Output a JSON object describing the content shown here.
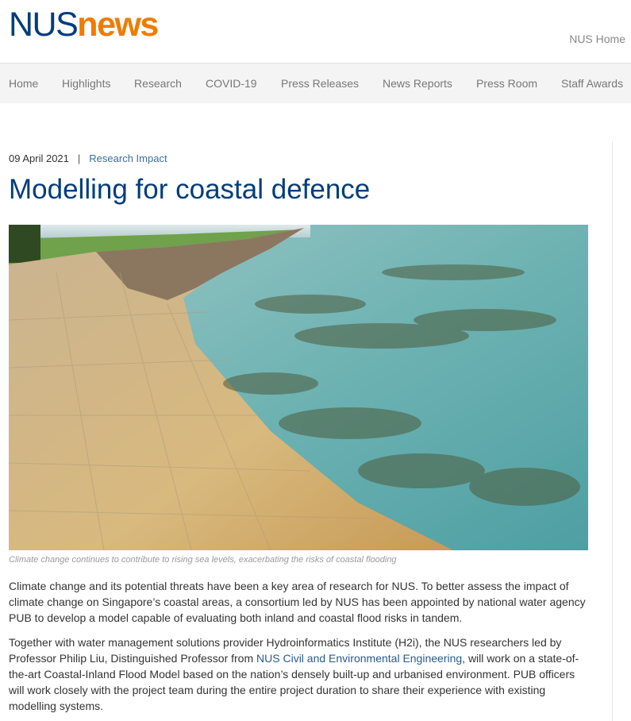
{
  "header": {
    "logo_part1": "NUS",
    "logo_part2": "news",
    "home_link": "NUS Home"
  },
  "nav": {
    "items": [
      {
        "label": "Home"
      },
      {
        "label": "Highlights"
      },
      {
        "label": "Research"
      },
      {
        "label": "COVID-19"
      },
      {
        "label": "Press Releases"
      },
      {
        "label": "News Reports"
      },
      {
        "label": "Press Room"
      },
      {
        "label": "Staff Awards"
      }
    ]
  },
  "article": {
    "date": "09 April 2021",
    "separator": "|",
    "category": "Research Impact",
    "title": "Modelling for coastal defence",
    "caption": "Climate change continues to contribute to rising sea levels, exacerbating the risks of coastal flooding",
    "paragraph1": "Climate change and its potential threats have been a key area of research for NUS. To better assess the impact of climate change on Singapore’s coastal areas, a consortium led by NUS has been appointed by national water agency PUB to develop a model capable of evaluating both inland and coastal flood risks in tandem.",
    "paragraph2_before": "Together with water management solutions provider Hydroinformatics Institute (H2i), the NUS researchers led by Professor Philip Liu, Distinguished Professor from ",
    "paragraph2_link": "NUS Civil and Environmental Engineering",
    "paragraph2_after": ", will work on a state-of-the-art Coastal-Inland Flood Model based on the nation’s densely built-up and urbanised environment. PUB officers will work closely with the project team during the entire project duration to share their experience with existing modelling systems."
  },
  "colors": {
    "brand_blue": "#003d7c",
    "brand_orange": "#ef7c00",
    "link_blue": "#2a5b8c"
  }
}
